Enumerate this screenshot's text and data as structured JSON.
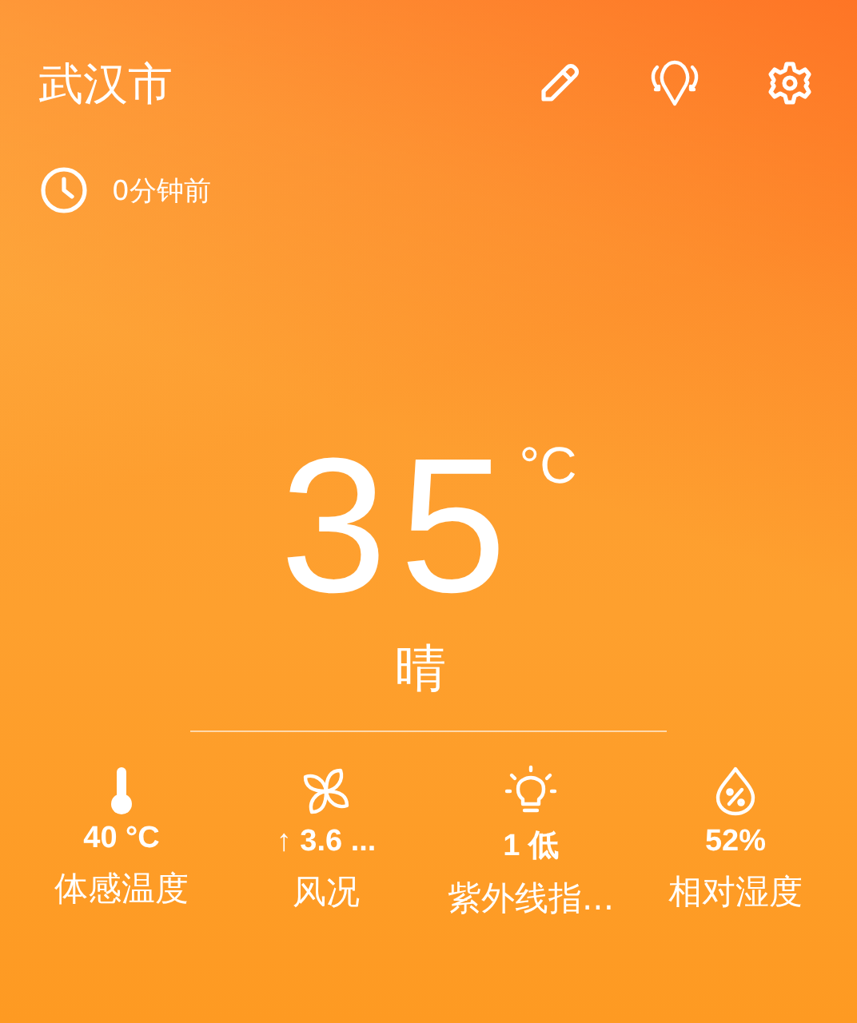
{
  "city": "武汉市",
  "updated": "0分钟前",
  "temperature": "35",
  "unit": "°C",
  "condition": "晴",
  "stats": [
    {
      "kind": "feels",
      "value": "40 °C",
      "label": "体感温度"
    },
    {
      "kind": "wind",
      "value": "↑ 3.6 ...",
      "label": "风况"
    },
    {
      "kind": "uv",
      "value": "1 低",
      "label": "紫外线指..."
    },
    {
      "kind": "humidity",
      "value": "52%",
      "label": "相对湿度"
    }
  ]
}
